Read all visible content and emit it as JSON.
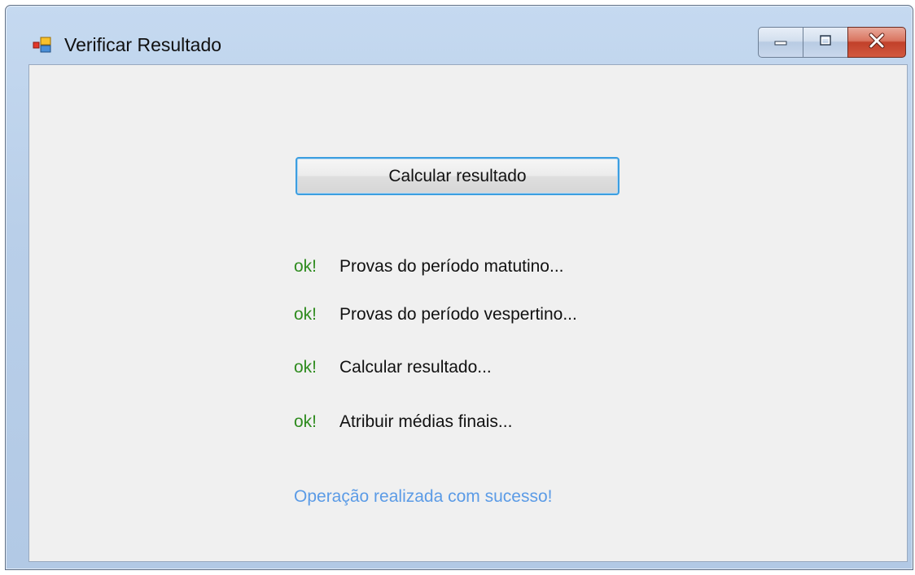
{
  "window": {
    "title": "Verificar Resultado",
    "icon": "app-form-icon"
  },
  "caption_buttons": {
    "minimize": "minimize-icon",
    "maximize": "maximize-icon",
    "close": "close-icon"
  },
  "main": {
    "calc_button_label": "Calcular resultado",
    "steps": [
      {
        "status": "ok!",
        "label": "Provas do período matutino..."
      },
      {
        "status": "ok!",
        "label": "Provas do período vespertino..."
      },
      {
        "status": "ok!",
        "label": "Calcular resultado..."
      },
      {
        "status": "ok!",
        "label": "Atribuir médias finais..."
      }
    ],
    "success_message": "Operação realizada com sucesso!"
  },
  "colors": {
    "ok_green": "#2e8b1e",
    "success_blue": "#5b9be6",
    "button_focus_border": "#3c9ee0",
    "close_red": "#c1402a"
  }
}
